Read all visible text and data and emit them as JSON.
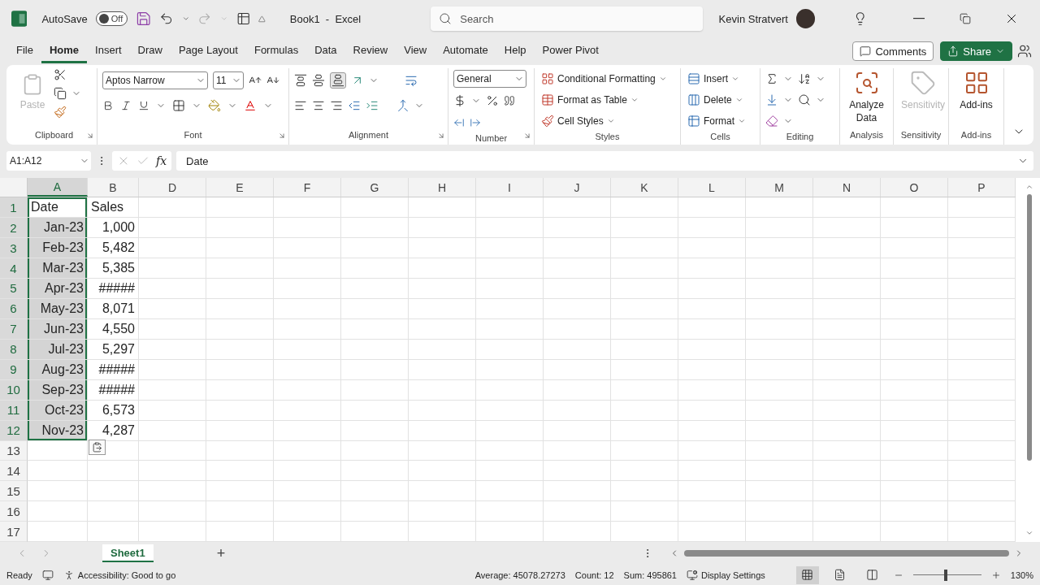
{
  "title_bar": {
    "autosave_label": "AutoSave",
    "autosave_toggle": {
      "label": "Off",
      "on": false
    },
    "document_title": "Book1  -  Excel",
    "search": {
      "placeholder": "Search"
    },
    "user_name": "Kevin Stratvert"
  },
  "menu_tabs": [
    {
      "label": "File",
      "selected": false
    },
    {
      "label": "Home",
      "selected": true
    },
    {
      "label": "Insert",
      "selected": false
    },
    {
      "label": "Draw",
      "selected": false
    },
    {
      "label": "Page Layout",
      "selected": false
    },
    {
      "label": "Formulas",
      "selected": false
    },
    {
      "label": "Data",
      "selected": false
    },
    {
      "label": "Review",
      "selected": false
    },
    {
      "label": "View",
      "selected": false
    },
    {
      "label": "Automate",
      "selected": false
    },
    {
      "label": "Help",
      "selected": false
    },
    {
      "label": "Power Pivot",
      "selected": false
    }
  ],
  "actions": {
    "comments": "Comments",
    "share": "Share"
  },
  "ribbon": {
    "clipboard": {
      "paste": {
        "label": "Paste",
        "disabled": true
      },
      "group_label": "Clipboard"
    },
    "font": {
      "font_name": "Aptos Narrow",
      "font_size": "11",
      "group_label": "Font"
    },
    "alignment": {
      "group_label": "Alignment"
    },
    "number": {
      "format": "General",
      "group_label": "Number"
    },
    "styles": {
      "items": [
        "Conditional Formatting",
        "Format as Table",
        "Cell Styles"
      ],
      "group_label": "Styles"
    },
    "cells": {
      "items": [
        "Insert",
        "Delete",
        "Format"
      ],
      "group_label": "Cells"
    },
    "editing": {
      "group_label": "Editing"
    },
    "analysis": {
      "button": {
        "label": "Analyze Data",
        "disabled": false
      },
      "group_label": "Analysis"
    },
    "sensitivity": {
      "button": {
        "label": "Sensitivity",
        "disabled": true
      },
      "group_label": "Sensitivity"
    },
    "add_ins": {
      "button": {
        "label": "Add-ins",
        "disabled": false
      },
      "group_label": "Add-ins"
    }
  },
  "formula_bar": {
    "name_box": "A1:A12",
    "fx": "fx",
    "value": "Date"
  },
  "sheet": {
    "columns": [
      {
        "label": "A",
        "selected": true
      },
      {
        "label": "B",
        "selected": false
      },
      {
        "label": "D",
        "selected": false
      },
      {
        "label": "E",
        "selected": false
      },
      {
        "label": "F",
        "selected": false
      },
      {
        "label": "G",
        "selected": false
      },
      {
        "label": "H",
        "selected": false
      },
      {
        "label": "I",
        "selected": false
      },
      {
        "label": "J",
        "selected": false
      },
      {
        "label": "K",
        "selected": false
      },
      {
        "label": "L",
        "selected": false
      },
      {
        "label": "M",
        "selected": false
      },
      {
        "label": "N",
        "selected": false
      },
      {
        "label": "O",
        "selected": false
      },
      {
        "label": "P",
        "selected": false
      }
    ],
    "rows": [
      {
        "label": "1",
        "selected": true,
        "cells": [
          "Date",
          "Sales"
        ]
      },
      {
        "label": "2",
        "selected": true,
        "cells": [
          "Jan-23",
          "1,000"
        ]
      },
      {
        "label": "3",
        "selected": true,
        "cells": [
          "Feb-23",
          "5,482"
        ]
      },
      {
        "label": "4",
        "selected": true,
        "cells": [
          "Mar-23",
          "5,385"
        ]
      },
      {
        "label": "5",
        "selected": true,
        "cells": [
          "Apr-23",
          "#####"
        ]
      },
      {
        "label": "6",
        "selected": true,
        "cells": [
          "May-23",
          "8,071"
        ]
      },
      {
        "label": "7",
        "selected": true,
        "cells": [
          "Jun-23",
          "4,550"
        ]
      },
      {
        "label": "8",
        "selected": true,
        "cells": [
          "Jul-23",
          "5,297"
        ]
      },
      {
        "label": "9",
        "selected": true,
        "cells": [
          "Aug-23",
          "#####"
        ]
      },
      {
        "label": "10",
        "selected": true,
        "cells": [
          "Sep-23",
          "#####"
        ]
      },
      {
        "label": "11",
        "selected": true,
        "cells": [
          "Oct-23",
          "6,573"
        ]
      },
      {
        "label": "12",
        "selected": true,
        "cells": [
          "Nov-23",
          "4,287"
        ]
      },
      {
        "label": "13",
        "selected": false,
        "cells": []
      },
      {
        "label": "14",
        "selected": false,
        "cells": []
      },
      {
        "label": "15",
        "selected": false,
        "cells": []
      },
      {
        "label": "16",
        "selected": false,
        "cells": []
      },
      {
        "label": "17",
        "selected": false,
        "cells": []
      }
    ]
  },
  "sheet_tabs": [
    {
      "label": "Sheet1",
      "selected": true
    }
  ],
  "add_sheet": "+",
  "status_bar": {
    "ready": "Ready",
    "accessibility": "Accessibility: Good to go",
    "average": "Average: 45078.27273",
    "count": "Count: 12",
    "sum": "Sum: 495861",
    "display_settings": "Display Settings",
    "views": [
      {
        "kind": "normal",
        "selected": true
      },
      {
        "kind": "page_layout",
        "selected": false
      },
      {
        "kind": "page_break",
        "selected": false
      }
    ],
    "zoom": {
      "level": 0.48,
      "label": "130%"
    }
  }
}
